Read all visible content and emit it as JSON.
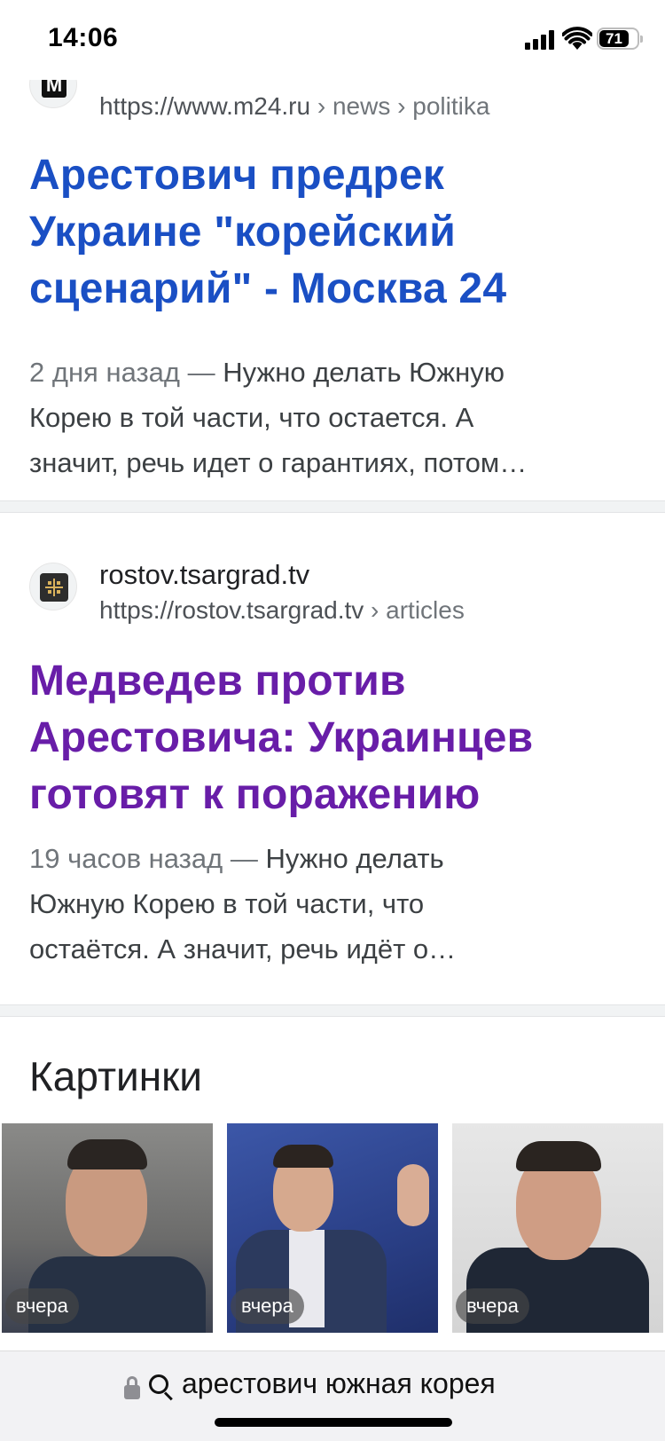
{
  "status_bar": {
    "time": "14:06",
    "battery": "71"
  },
  "results": [
    {
      "site_name": "",
      "url": "https://www.m24.ru",
      "breadcrumbs": [
        "news",
        "politika"
      ],
      "favicon_letter": "M",
      "title_lines": [
        "Арестович предрек",
        "Украине \"корейский",
        "сценарий\" - Москва 24"
      ],
      "date": "2 дня назад",
      "snippet_lines": [
        "Нужно делать Южную",
        "Корею в той части, что остается. А",
        "значит, речь идет о гарантиях, потом…"
      ],
      "title_color": "#1a4fc4"
    },
    {
      "site_name": "rostov.tsargrad.tv",
      "url": "https://rostov.tsargrad.tv",
      "breadcrumbs": [
        "articles"
      ],
      "title_lines": [
        "Медведев против",
        "Арестовича: Украинцев",
        "готовят к поражению"
      ],
      "date": "19 часов назад",
      "snippet_lines": [
        "Нужно делать",
        "Южную Корею в той части, что",
        "остаётся. А значит, речь идёт о…"
      ],
      "title_color": "#681da8"
    }
  ],
  "images": {
    "heading": "Картинки",
    "thumbnails": [
      {
        "badge": "вчера"
      },
      {
        "badge": "вчера"
      },
      {
        "badge": "вчера"
      }
    ]
  },
  "address_bar": {
    "query": "арестович южная корея"
  },
  "icons": [
    "signal-icon",
    "wifi-icon",
    "battery-icon",
    "lock-icon",
    "search-icon"
  ]
}
